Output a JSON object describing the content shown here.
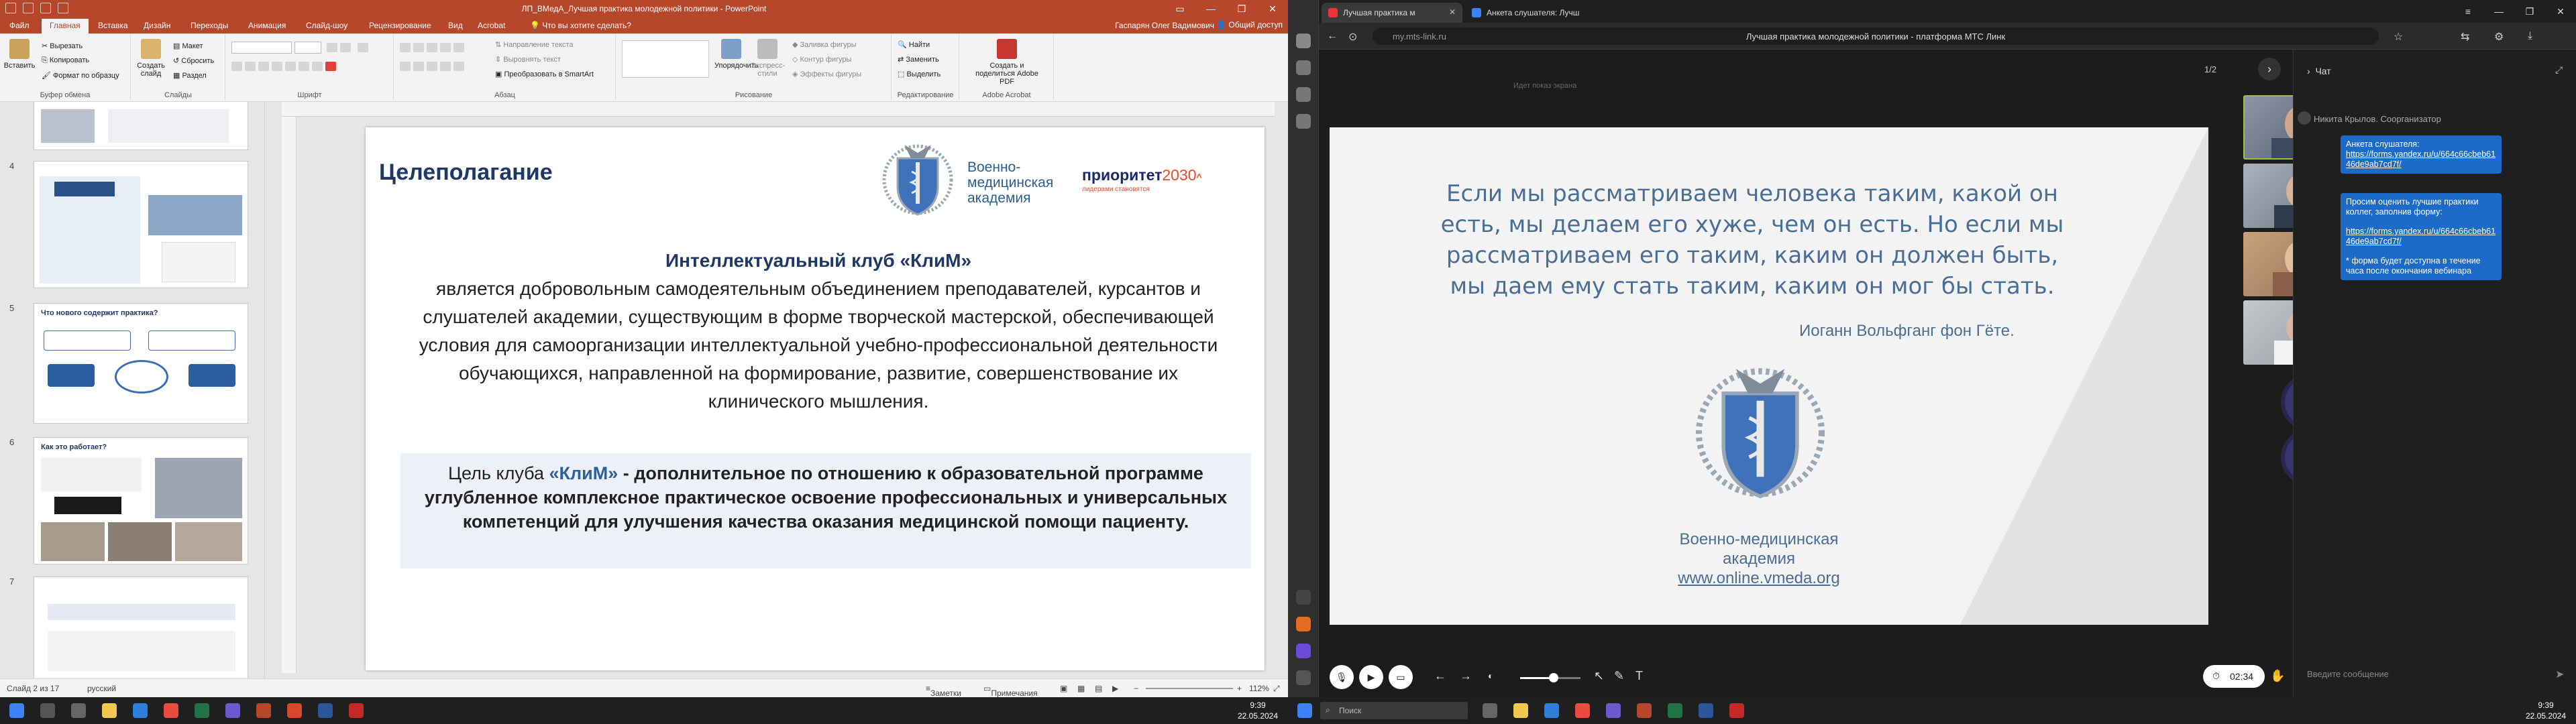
{
  "ppt": {
    "window_title": "ЛП_ВМедА_Лучшая практика молодежной политики - PowerPoint",
    "tabs": [
      "Файл",
      "Главная",
      "Вставка",
      "Дизайн",
      "Переходы",
      "Анимация",
      "Слайд-шоу",
      "Рецензирование",
      "Вид",
      "Acrobat"
    ],
    "search": "Что вы хотите сделать?",
    "user": "Гаспарян Олег Вадимович",
    "share": "Общий доступ",
    "ribbon": {
      "paste": "Вставить",
      "cut": "Вырезать",
      "copy": "Копировать",
      "format_painter": "Формат по образцу",
      "clipboard_group": "Буфер обмена",
      "new_slide": "Создать слайд",
      "layout": "Макет",
      "reset": "Сбросить",
      "section": "Раздел",
      "slides_group": "Слайды",
      "font_group": "Шрифт",
      "text_direction": "Направление текста",
      "align_text": "Выровнять текст",
      "smartart": "Преобразовать в SmartArt",
      "paragraph_group": "Абзац",
      "arrange": "Упорядочить",
      "quick_styles": "Экспресс-стили",
      "shape_fill": "Заливка фигуры",
      "shape_outline": "Контур фигуры",
      "shape_effects": "Эффекты фигуры",
      "drawing_group": "Рисование",
      "find": "Найти",
      "replace": "Заменить",
      "select": "Выделить",
      "editing_group": "Редактирование",
      "create_pdf": "Создать и поделиться Adobe PDF",
      "acrobat_group": "Adobe Acrobat"
    },
    "thumbs": [
      {
        "num": "4",
        "title": ""
      },
      {
        "num": "5",
        "title": "Что нового содержит практика?"
      },
      {
        "num": "6",
        "title": "Как это работает?"
      },
      {
        "num": "7",
        "title": ""
      }
    ],
    "slide": {
      "title": "Целеполагание",
      "vma_lines": [
        "Военно-",
        "медицинская",
        "академия"
      ],
      "prio_name": "приоритет",
      "prio_num": "2030",
      "prio_sub": "лидерами становятся",
      "club_name": "Интеллектуальный клуб «КлиМ»",
      "club_text": "является добровольным самодеятельным объединением преподавателей, курсантов и слушателей академии, существующим в форме творческой мастерской, обеспечивающей условия для самоорганизации интеллектуальной учебно-профессиональной деятельности обучающихся, направленной на формирование, развитие, совершенствование их клинического мышления.",
      "goal_lead": "Цель клуба ",
      "goal_name": "«КлиМ»",
      "goal_text": " - дополнительное по отношению к образовательной программе углубленное комплексное практическое освоение профессиональных и универсальных компетенций для улучшения качества оказания медицинской помощи пациенту."
    },
    "status": {
      "slide_counter": "Слайд 2 из 17",
      "language": "русский",
      "notes": "Заметки",
      "comments": "Примечания",
      "zoom": "112%"
    }
  },
  "taskbar_left": {
    "time": "9:39",
    "date": "22.05.2024"
  },
  "browser": {
    "tabs": [
      {
        "label": "Лучшая практика м",
        "active": true
      },
      {
        "label": "Анкета слушателя: Лучш",
        "active": false
      }
    ],
    "url": "my.mts-link.ru",
    "page_title": "Лучшая практика молодежной политики - платформа МТС Линк"
  },
  "webinar": {
    "pager": "1/2",
    "shared_hint": "Идет показ экрана",
    "quote": "Если мы рассматриваем человека таким, какой он есть, мы делаем его хуже, чем он есть. Но если мы рассматриваем его таким, каким он должен быть, мы даем ему стать таким, каким он мог бы стать.",
    "author": "Иоганн Вольфганг фон Гёте.",
    "vma_lines": [
      "Военно-медицинская",
      "академия"
    ],
    "vma_url": "www.online.vmeda.org",
    "timer": "02:34",
    "zoom_level": 0.55
  },
  "chat": {
    "title": "Чат",
    "author": "Никита Крылов. Соорганизатор",
    "messages": [
      {
        "text": "Анкета слушателя:",
        "link": "https://forms.yandex.ru/u/664c66cbeb6146de9ab7cd7f/"
      },
      {
        "text": "Просим оценить лучшие практики коллег, заполнив форму:",
        "link": "https://forms.yandex.ru/u/664c66cbeb6146de9ab7cd7f/",
        "note": "* форма будет доступна в течение часа после окончания вебинара"
      }
    ],
    "input_placeholder": "Введите сообщение"
  },
  "taskbar_right": {
    "search": "Поиск",
    "time": "9:39",
    "date": "22.05.2024"
  },
  "colors": {
    "ppt_accent": "#b7472a",
    "slide_title": "#1f3864",
    "quote": "#4a6e95",
    "chat_bubble": "#1e6ac8",
    "mic_badge": "#5b50c0"
  }
}
